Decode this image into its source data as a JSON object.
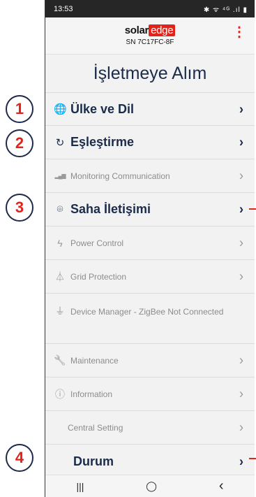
{
  "status": {
    "time": "13:53",
    "icons": "✱ ᯤ ⁴ᴳ .ıl ▮"
  },
  "header": {
    "logo_a": "solar",
    "logo_b": "edge",
    "serial": "SN 7C17FC-8F",
    "menu_glyph": "⋮"
  },
  "page_title": "İşletmeye Alım",
  "menu": [
    {
      "label": "Ülke ve Dil",
      "icon": "globe-icon",
      "glyph": "🌐",
      "active": true
    },
    {
      "label": "Eşleştirme",
      "icon": "sync-icon",
      "glyph": "↻",
      "active": true
    },
    {
      "label": "Monitoring Communication",
      "icon": "bar-chart-icon",
      "glyph": "▂▄▆",
      "active": false
    },
    {
      "label": "Saha İletişimi",
      "icon": "location-pin-icon",
      "glyph": "⌾",
      "active": true
    },
    {
      "label": "Power Control",
      "icon": "bolt-icon",
      "glyph": "ϟ",
      "active": false
    },
    {
      "label": "Grid Protection",
      "icon": "tower-icon",
      "glyph": "⏃",
      "active": false
    },
    {
      "label": "Device Manager - ZigBee Not Connected",
      "icon": "plug-icon",
      "glyph": "⏚",
      "active": false
    },
    {
      "label": "Maintenance",
      "icon": "wrench-icon",
      "glyph": "🔧",
      "active": false
    },
    {
      "label": "Information",
      "icon": "info-icon",
      "glyph": "ⓘ",
      "active": false
    },
    {
      "label": "Central Setting",
      "icon": "",
      "glyph": "",
      "active": false
    },
    {
      "label": "Durum",
      "icon": "",
      "glyph": "",
      "active": true
    }
  ],
  "chevron": "›",
  "badges": [
    "1",
    "2",
    "3",
    "4"
  ],
  "navbar": {
    "recents": "|||",
    "home": "◯",
    "back": "‹"
  }
}
